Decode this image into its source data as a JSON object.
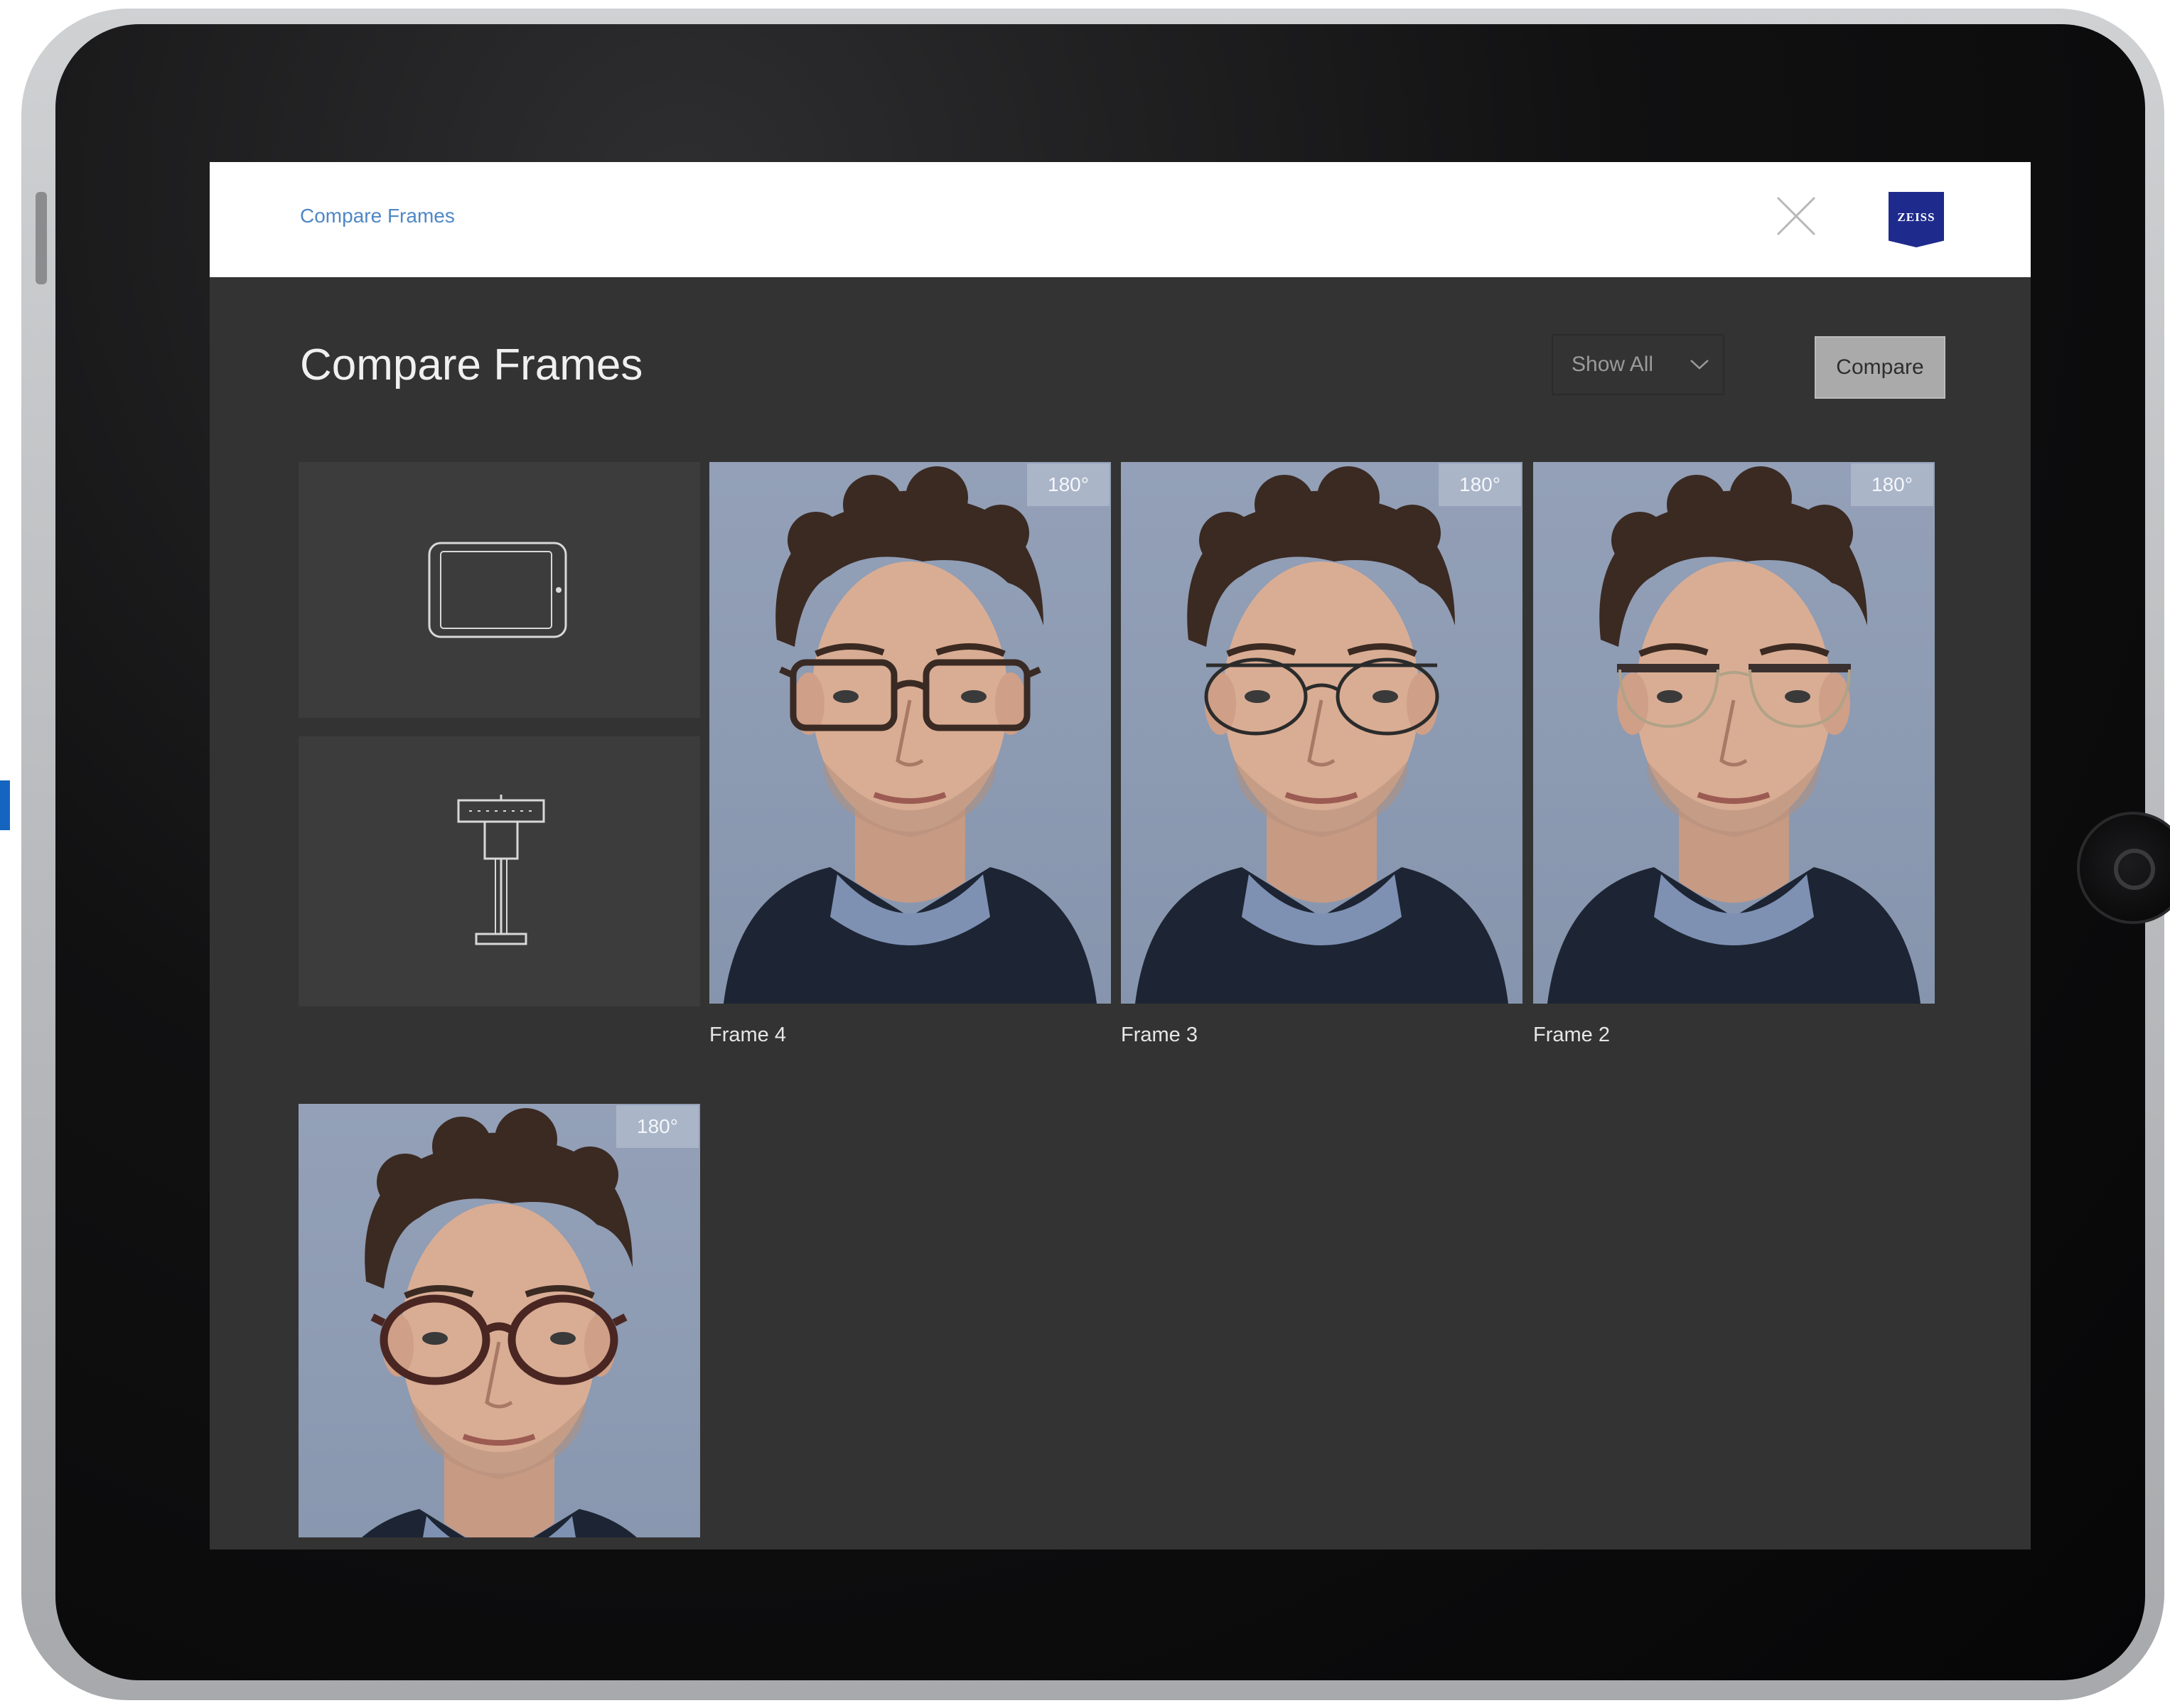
{
  "header": {
    "breadcrumb": "Compare Frames",
    "logo_text": "ZEISS"
  },
  "main": {
    "title": "Compare Frames",
    "filter": {
      "value": "Show All"
    },
    "compare_label": "Compare"
  },
  "frames": [
    {
      "label": "Frame 4",
      "angle": "180°",
      "glasses": "rect-dark"
    },
    {
      "label": "Frame 3",
      "angle": "180°",
      "glasses": "round-wire"
    },
    {
      "label": "Frame 2",
      "angle": "180°",
      "glasses": "browline"
    },
    {
      "label": "",
      "angle": "180°",
      "glasses": "round-tortoise"
    }
  ],
  "icons": {
    "close": "close-icon",
    "tablet": "tablet-icon",
    "stand": "stand-icon",
    "dropdown": "chevron-down-icon"
  },
  "colors": {
    "screen_bg": "#333333",
    "topbar_bg": "#ffffff",
    "breadcrumb": "#4f87c5",
    "logo_bg": "#1e2a8c",
    "button_bg": "#aaaaaa"
  }
}
